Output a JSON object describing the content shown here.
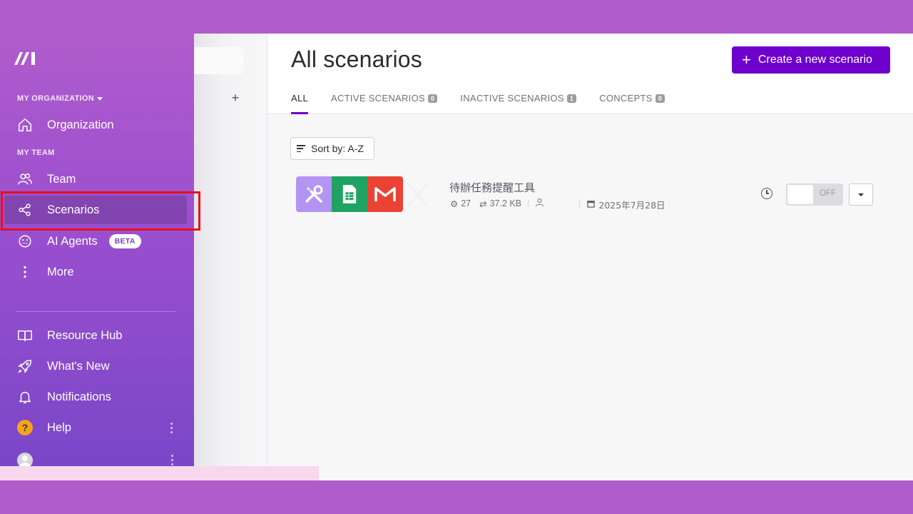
{
  "sidebar": {
    "org_section": "MY ORGANIZATION",
    "team_section": "MY TEAM",
    "items": [
      {
        "label": "Organization",
        "icon": "home-icon"
      },
      {
        "label": "Team",
        "icon": "people-icon"
      },
      {
        "label": "Scenarios",
        "icon": "share-icon",
        "active": true
      },
      {
        "label": "AI Agents",
        "icon": "ai-agent-icon",
        "badge": "BETA"
      },
      {
        "label": "More",
        "icon": "more-vertical-icon"
      },
      {
        "label": "Resource Hub",
        "icon": "book-icon"
      },
      {
        "label": "What's New",
        "icon": "rocket-icon"
      },
      {
        "label": "Notifications",
        "icon": "bell-icon"
      },
      {
        "label": "Help",
        "icon": "help-icon"
      }
    ],
    "help_glyph": "?"
  },
  "folder_panel": {
    "add_glyph": "+"
  },
  "header": {
    "title": "All scenarios",
    "create_button": "Create a new scenario",
    "create_button_color": "#6d00cc"
  },
  "tabs": [
    {
      "label": "ALL",
      "active": true
    },
    {
      "label": "ACTIVE SCENARIOS",
      "count": "0"
    },
    {
      "label": "INACTIVE SCENARIOS",
      "count": "1"
    },
    {
      "label": "CONCEPTS",
      "count": "0"
    }
  ],
  "sort": {
    "label": "Sort by: A-Z"
  },
  "scenarios": [
    {
      "name": "待辦任務提醒工具",
      "operations": "27",
      "data_size": "37.2 KB",
      "date": "2025年7月28日",
      "status": "OFF",
      "apps": [
        "tools-icon",
        "google-sheets-icon",
        "gmail-icon"
      ]
    }
  ],
  "colors": {
    "frame": "#b05ccc",
    "accent": "#6d00cc",
    "highlight": "#e8101a"
  }
}
